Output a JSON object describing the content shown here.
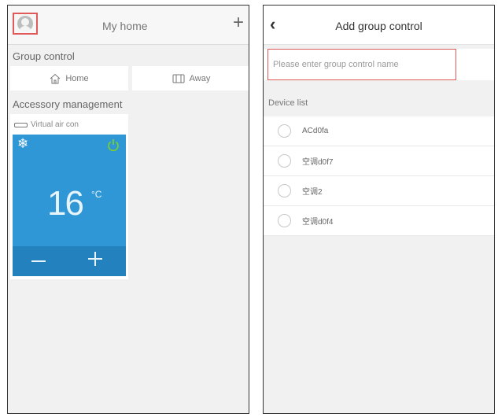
{
  "left": {
    "title": "My home",
    "group_control_label": "Group control",
    "group_buttons": [
      {
        "label": "Home",
        "icon": "home-icon"
      },
      {
        "label": "Away",
        "icon": "away-icon"
      }
    ],
    "accessory_label": "Accessory management",
    "accessory": {
      "name": "Virtual air con",
      "temperature": "16",
      "unit": "°C",
      "mode_icon": "snowflake-icon",
      "power_color": "#7ed321",
      "tile_color": "#2f97d6"
    }
  },
  "right": {
    "back_icon": "back-chevron-icon",
    "title": "Add group control",
    "name_placeholder": "Please enter group control name",
    "device_list_label": "Device list",
    "devices": [
      "ACd0fa",
      "空调d0f7",
      "空调2",
      "空调d0f4"
    ]
  },
  "colors": {
    "highlight": "#e05a5a",
    "ac_blue": "#2f97d6"
  }
}
